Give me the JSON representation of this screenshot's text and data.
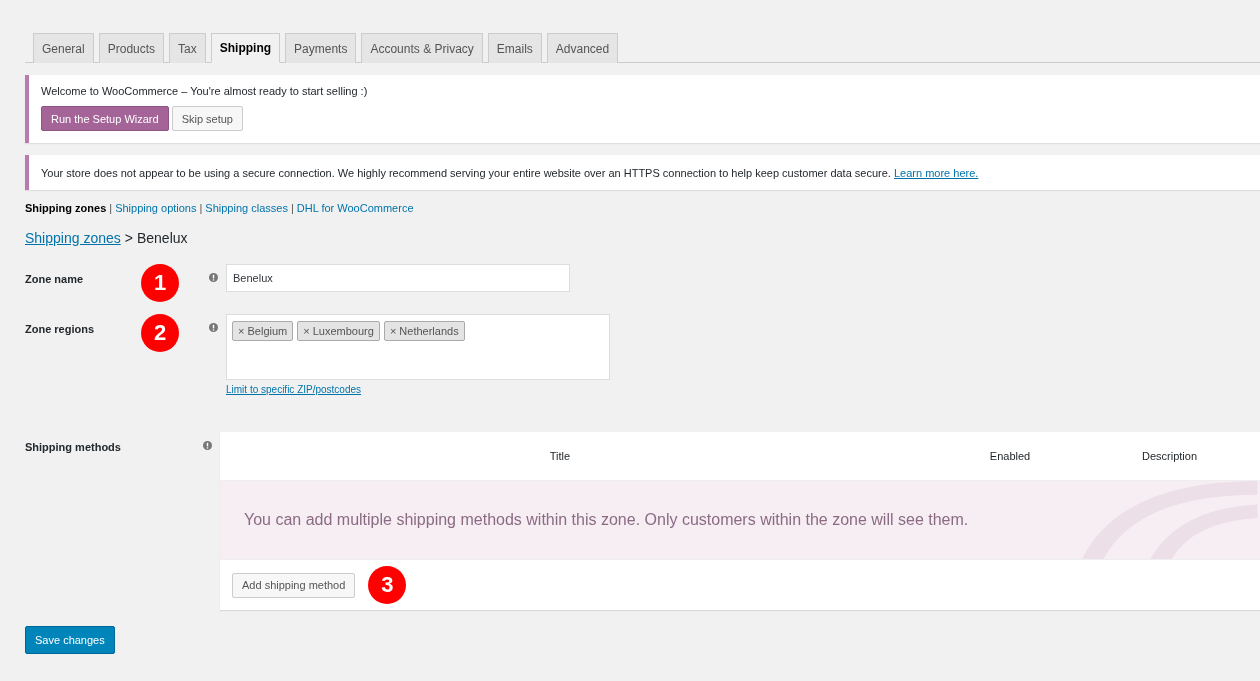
{
  "tabs": [
    {
      "label": "General",
      "selected": false
    },
    {
      "label": "Products",
      "selected": false
    },
    {
      "label": "Tax",
      "selected": false
    },
    {
      "label": "Shipping",
      "selected": true
    },
    {
      "label": "Payments",
      "selected": false
    },
    {
      "label": "Accounts & Privacy",
      "selected": false
    },
    {
      "label": "Emails",
      "selected": false
    },
    {
      "label": "Advanced",
      "selected": false
    }
  ],
  "welcome_notice": {
    "text": "Welcome to WooCommerce – You're almost ready to start selling :)",
    "buttons": [
      {
        "label": "Run the Setup Wizard",
        "kind": "primary"
      },
      {
        "label": "Skip setup",
        "kind": "secondary"
      }
    ]
  },
  "security_notice": {
    "text": "Your store does not appear to be using a secure connection. We highly recommend serving your entire website over an HTTPS connection to help keep customer data secure.",
    "link": "Learn more here."
  },
  "subnav_separator": "|",
  "subnav": [
    {
      "label": "Shipping zones",
      "selected": true
    },
    {
      "label": "Shipping options",
      "selected": false
    },
    {
      "label": "Shipping classes",
      "selected": false
    },
    {
      "label": "DHL for WooCommerce",
      "selected": false
    }
  ],
  "breadcrumb": {
    "link": "Shipping zones",
    "separator": ">",
    "current": "Benelux"
  },
  "zone_name": {
    "label": "Zone name",
    "marker": "1",
    "value": "Benelux"
  },
  "zone_regions": {
    "label": "Zone regions",
    "marker": "2",
    "tags": [
      "Belgium",
      "Luxembourg",
      "Netherlands"
    ],
    "tag_remove": "×",
    "link": "Limit to specific ZIP/postcodes"
  },
  "shipping_methods": {
    "label": "Shipping methods",
    "columns": [
      "Title",
      "Enabled",
      "Description"
    ],
    "empty_message": "You can add multiple shipping methods within this zone. Only customers within the zone will see them.",
    "add_button": "Add shipping method",
    "marker": "3"
  },
  "save_button": "Save changes"
}
